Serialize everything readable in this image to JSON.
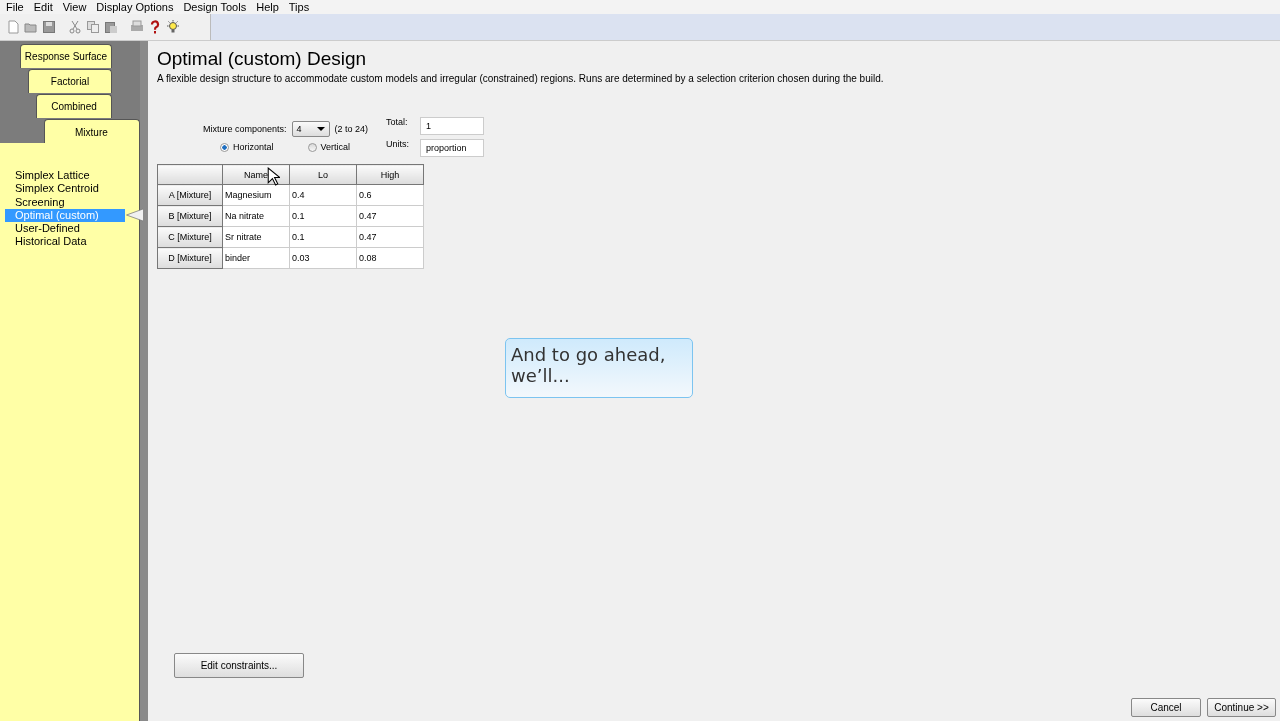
{
  "menu": [
    "File",
    "Edit",
    "View",
    "Display Options",
    "Design Tools",
    "Help",
    "Tips"
  ],
  "tabs": [
    {
      "label": "Response Surface",
      "selected": false
    },
    {
      "label": "Factorial",
      "selected": false
    },
    {
      "label": "Combined",
      "selected": false
    },
    {
      "label": "Mixture",
      "selected": true
    }
  ],
  "design_list": [
    {
      "label": "Simplex Lattice",
      "selected": false
    },
    {
      "label": "Simplex Centroid",
      "selected": false
    },
    {
      "label": "Screening",
      "selected": false
    },
    {
      "label": "Optimal (custom)",
      "selected": true
    },
    {
      "label": "User-Defined",
      "selected": false
    },
    {
      "label": "Historical Data",
      "selected": false
    }
  ],
  "title": "Optimal (custom) Design",
  "description": "A flexible design structure to accommodate custom models and irregular (constrained) regions.  Runs are determined by a selection criterion chosen during the build.",
  "components": {
    "label": "Mixture components:",
    "value": "4",
    "range": "(2 to 24)"
  },
  "orientation": [
    {
      "label": "Horizontal",
      "selected": true
    },
    {
      "label": "Vertical",
      "selected": false
    }
  ],
  "total": {
    "label": "Total:",
    "value": "1"
  },
  "units": {
    "label": "Units:",
    "value": "proportion"
  },
  "table": {
    "columns": [
      "Name",
      "Lo",
      "High"
    ],
    "rows": [
      {
        "header": "A [Mixture]",
        "cells": [
          "Magnesium",
          "0.4",
          "0.6"
        ]
      },
      {
        "header": "B [Mixture]",
        "cells": [
          "Na nitrate",
          "0.1",
          "0.47"
        ]
      },
      {
        "header": "C [Mixture]",
        "cells": [
          "Sr nitrate",
          "0.1",
          "0.47"
        ]
      },
      {
        "header": "D [Mixture]",
        "cells": [
          "binder",
          "0.03",
          "0.08"
        ]
      }
    ]
  },
  "caption": "And to go ahead, we’ll...",
  "edit_button": "Edit constraints...",
  "buttons": [
    "Cancel",
    "Continue >>"
  ]
}
